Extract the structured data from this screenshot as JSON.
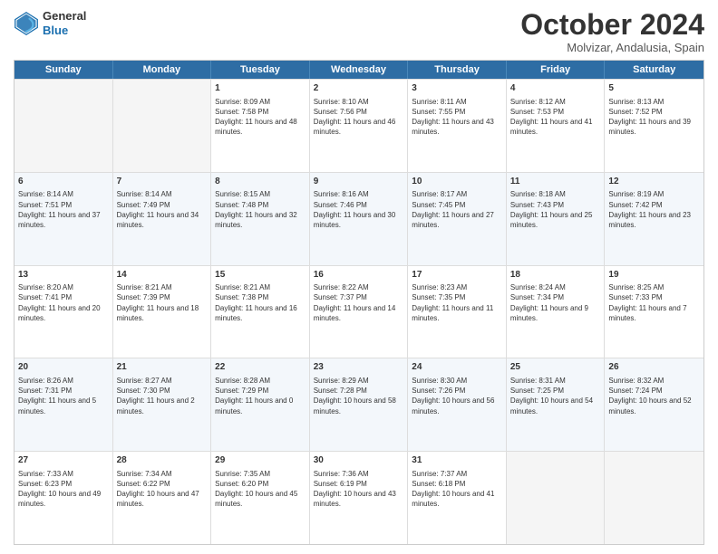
{
  "header": {
    "logo_line1": "General",
    "logo_line2": "Blue",
    "month_title": "October 2024",
    "location": "Molvizar, Andalusia, Spain"
  },
  "days_of_week": [
    "Sunday",
    "Monday",
    "Tuesday",
    "Wednesday",
    "Thursday",
    "Friday",
    "Saturday"
  ],
  "rows": [
    [
      {
        "day": "",
        "info": ""
      },
      {
        "day": "",
        "info": ""
      },
      {
        "day": "1",
        "info": "Sunrise: 8:09 AM\nSunset: 7:58 PM\nDaylight: 11 hours and 48 minutes."
      },
      {
        "day": "2",
        "info": "Sunrise: 8:10 AM\nSunset: 7:56 PM\nDaylight: 11 hours and 46 minutes."
      },
      {
        "day": "3",
        "info": "Sunrise: 8:11 AM\nSunset: 7:55 PM\nDaylight: 11 hours and 43 minutes."
      },
      {
        "day": "4",
        "info": "Sunrise: 8:12 AM\nSunset: 7:53 PM\nDaylight: 11 hours and 41 minutes."
      },
      {
        "day": "5",
        "info": "Sunrise: 8:13 AM\nSunset: 7:52 PM\nDaylight: 11 hours and 39 minutes."
      }
    ],
    [
      {
        "day": "6",
        "info": "Sunrise: 8:14 AM\nSunset: 7:51 PM\nDaylight: 11 hours and 37 minutes."
      },
      {
        "day": "7",
        "info": "Sunrise: 8:14 AM\nSunset: 7:49 PM\nDaylight: 11 hours and 34 minutes."
      },
      {
        "day": "8",
        "info": "Sunrise: 8:15 AM\nSunset: 7:48 PM\nDaylight: 11 hours and 32 minutes."
      },
      {
        "day": "9",
        "info": "Sunrise: 8:16 AM\nSunset: 7:46 PM\nDaylight: 11 hours and 30 minutes."
      },
      {
        "day": "10",
        "info": "Sunrise: 8:17 AM\nSunset: 7:45 PM\nDaylight: 11 hours and 27 minutes."
      },
      {
        "day": "11",
        "info": "Sunrise: 8:18 AM\nSunset: 7:43 PM\nDaylight: 11 hours and 25 minutes."
      },
      {
        "day": "12",
        "info": "Sunrise: 8:19 AM\nSunset: 7:42 PM\nDaylight: 11 hours and 23 minutes."
      }
    ],
    [
      {
        "day": "13",
        "info": "Sunrise: 8:20 AM\nSunset: 7:41 PM\nDaylight: 11 hours and 20 minutes."
      },
      {
        "day": "14",
        "info": "Sunrise: 8:21 AM\nSunset: 7:39 PM\nDaylight: 11 hours and 18 minutes."
      },
      {
        "day": "15",
        "info": "Sunrise: 8:21 AM\nSunset: 7:38 PM\nDaylight: 11 hours and 16 minutes."
      },
      {
        "day": "16",
        "info": "Sunrise: 8:22 AM\nSunset: 7:37 PM\nDaylight: 11 hours and 14 minutes."
      },
      {
        "day": "17",
        "info": "Sunrise: 8:23 AM\nSunset: 7:35 PM\nDaylight: 11 hours and 11 minutes."
      },
      {
        "day": "18",
        "info": "Sunrise: 8:24 AM\nSunset: 7:34 PM\nDaylight: 11 hours and 9 minutes."
      },
      {
        "day": "19",
        "info": "Sunrise: 8:25 AM\nSunset: 7:33 PM\nDaylight: 11 hours and 7 minutes."
      }
    ],
    [
      {
        "day": "20",
        "info": "Sunrise: 8:26 AM\nSunset: 7:31 PM\nDaylight: 11 hours and 5 minutes."
      },
      {
        "day": "21",
        "info": "Sunrise: 8:27 AM\nSunset: 7:30 PM\nDaylight: 11 hours and 2 minutes."
      },
      {
        "day": "22",
        "info": "Sunrise: 8:28 AM\nSunset: 7:29 PM\nDaylight: 11 hours and 0 minutes."
      },
      {
        "day": "23",
        "info": "Sunrise: 8:29 AM\nSunset: 7:28 PM\nDaylight: 10 hours and 58 minutes."
      },
      {
        "day": "24",
        "info": "Sunrise: 8:30 AM\nSunset: 7:26 PM\nDaylight: 10 hours and 56 minutes."
      },
      {
        "day": "25",
        "info": "Sunrise: 8:31 AM\nSunset: 7:25 PM\nDaylight: 10 hours and 54 minutes."
      },
      {
        "day": "26",
        "info": "Sunrise: 8:32 AM\nSunset: 7:24 PM\nDaylight: 10 hours and 52 minutes."
      }
    ],
    [
      {
        "day": "27",
        "info": "Sunrise: 7:33 AM\nSunset: 6:23 PM\nDaylight: 10 hours and 49 minutes."
      },
      {
        "day": "28",
        "info": "Sunrise: 7:34 AM\nSunset: 6:22 PM\nDaylight: 10 hours and 47 minutes."
      },
      {
        "day": "29",
        "info": "Sunrise: 7:35 AM\nSunset: 6:20 PM\nDaylight: 10 hours and 45 minutes."
      },
      {
        "day": "30",
        "info": "Sunrise: 7:36 AM\nSunset: 6:19 PM\nDaylight: 10 hours and 43 minutes."
      },
      {
        "day": "31",
        "info": "Sunrise: 7:37 AM\nSunset: 6:18 PM\nDaylight: 10 hours and 41 minutes."
      },
      {
        "day": "",
        "info": ""
      },
      {
        "day": "",
        "info": ""
      }
    ]
  ]
}
